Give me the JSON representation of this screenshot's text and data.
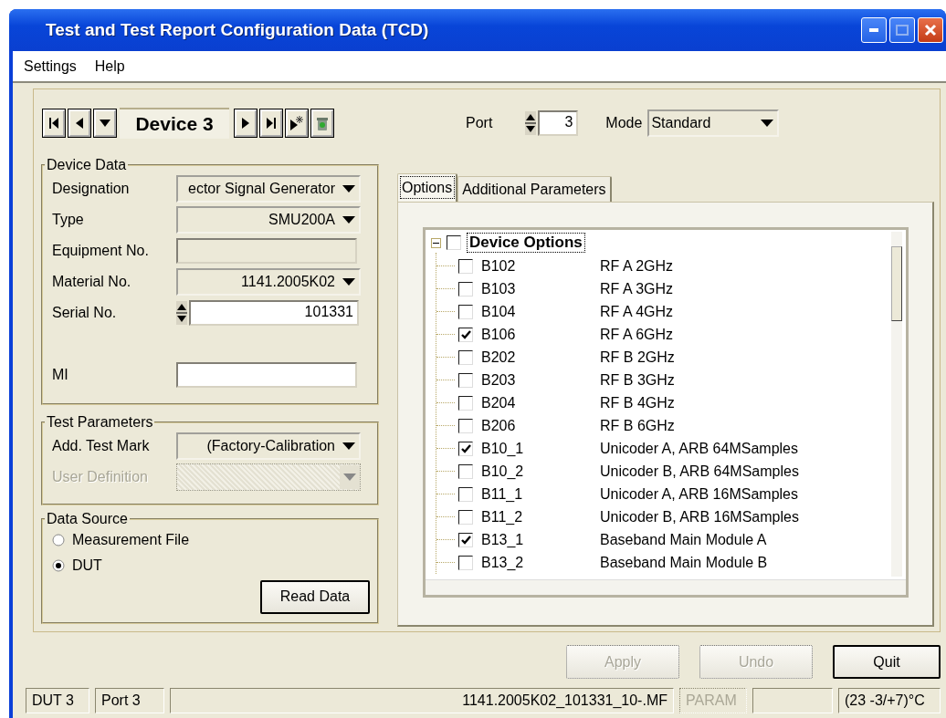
{
  "window": {
    "title": "Test and Test Report Configuration Data (TCD)"
  },
  "menu": [
    "Settings",
    "Help"
  ],
  "navigator": {
    "device": "Device 3"
  },
  "port": {
    "label": "Port",
    "value": "3"
  },
  "mode": {
    "label": "Mode",
    "value": "Standard"
  },
  "device_data": {
    "title": "Device Data",
    "fields": [
      {
        "label": "Designation",
        "kind": "dropdown",
        "value": "ector Signal Generator",
        "disabled": false
      },
      {
        "label": "Type",
        "kind": "dropdown",
        "value": "SMU200A",
        "disabled": false
      },
      {
        "label": "Equipment No.",
        "kind": "readonly",
        "disabled": false
      },
      {
        "label": "Material No.",
        "kind": "dropdown",
        "value": "1141.2005K02",
        "disabled": false
      },
      {
        "label": "Serial No.",
        "kind": "spin",
        "value": "101331",
        "disabled": false
      },
      {
        "label": "MI",
        "kind": "text",
        "disabled": false
      }
    ]
  },
  "test_parameters": {
    "title": "Test Parameters",
    "fields": [
      {
        "label": "Add. Test Mark",
        "kind": "dropdown",
        "value": "(Factory-Calibration",
        "disabled": false
      },
      {
        "label": "User Definition",
        "kind": "dropdown",
        "disabled": true
      }
    ]
  },
  "data_source": {
    "title": "Data Source",
    "options": [
      {
        "label": "Measurement File",
        "selected": false
      },
      {
        "label": "DUT",
        "selected": true
      }
    ],
    "button": "Read Data"
  },
  "tabs": [
    {
      "label": "Options",
      "selected": true
    },
    {
      "label": "Additional Parameters",
      "selected": false
    }
  ],
  "tree": {
    "label": "Device Options",
    "checked": false,
    "expanded": true,
    "children": [
      {
        "code": "B102",
        "description": "RF A 2GHz",
        "checked": false
      },
      {
        "code": "B103",
        "description": "RF A 3GHz",
        "checked": false
      },
      {
        "code": "B104",
        "description": "RF A 4GHz",
        "checked": false
      },
      {
        "code": "B106",
        "description": "RF A 6GHz",
        "checked": true
      },
      {
        "code": "B202",
        "description": "RF B 2GHz",
        "checked": false
      },
      {
        "code": "B203",
        "description": "RF B 3GHz",
        "checked": false
      },
      {
        "code": "B204",
        "description": "RF B 4GHz",
        "checked": false
      },
      {
        "code": "B206",
        "description": "RF B 6GHz",
        "checked": false
      },
      {
        "code": "B10_1",
        "description": "Unicoder A, ARB 64MSamples",
        "checked": true
      },
      {
        "code": "B10_2",
        "description": "Unicoder B, ARB 64MSamples",
        "checked": false
      },
      {
        "code": "B11_1",
        "description": "Unicoder A, ARB 16MSamples",
        "checked": false
      },
      {
        "code": "B11_2",
        "description": "Unicoder B, ARB 16MSamples",
        "checked": false
      },
      {
        "code": "B13_1",
        "description": "Baseband Main Module A",
        "checked": true
      },
      {
        "code": "B13_2",
        "description": "Baseband Main Module B",
        "checked": false
      }
    ]
  },
  "buttons": [
    {
      "label": "Apply",
      "disabled": true
    },
    {
      "label": "Undo",
      "disabled": true
    },
    {
      "label": "Quit",
      "disabled": false
    }
  ],
  "status_bar": [
    {
      "text": "DUT 3",
      "disabled": false
    },
    {
      "text": "Port 3",
      "disabled": false
    },
    {
      "text": "1141.2005K02_101331_10-.MF",
      "disabled": false
    },
    {
      "text": "PARAM",
      "disabled": true
    },
    {
      "disabled": false
    },
    {
      "text": "(23 -3/+7)°C",
      "disabled": false
    }
  ]
}
